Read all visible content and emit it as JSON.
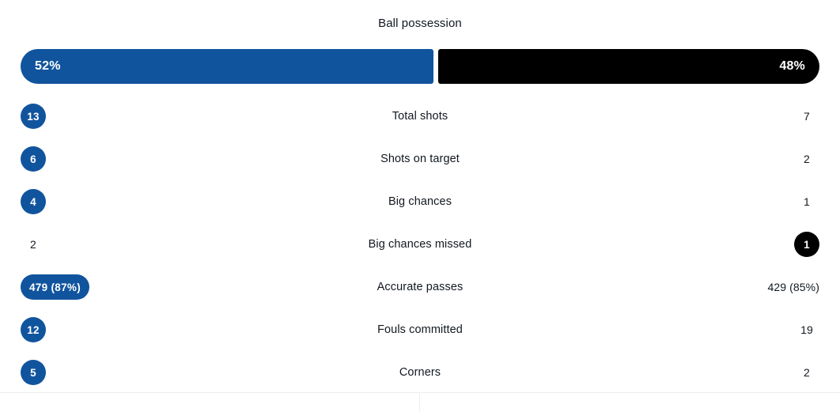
{
  "panel": {
    "possession": {
      "title": "Ball possession",
      "home_label": "52%",
      "away_label": "48%",
      "home_value": 52,
      "away_value": 48,
      "home_color": "#11549e",
      "away_color": "#000000"
    },
    "stats": [
      {
        "label": "Total shots",
        "home": "13",
        "away": "7",
        "home_highlight": true,
        "away_highlight": false
      },
      {
        "label": "Shots on target",
        "home": "6",
        "away": "2",
        "home_highlight": true,
        "away_highlight": false
      },
      {
        "label": "Big chances",
        "home": "4",
        "away": "1",
        "home_highlight": true,
        "away_highlight": false
      },
      {
        "label": "Big chances missed",
        "home": "2",
        "away": "1",
        "home_highlight": false,
        "away_highlight": true
      },
      {
        "label": "Accurate passes",
        "home": "479 (87%)",
        "away": "429 (85%)",
        "home_highlight": true,
        "away_highlight": false
      },
      {
        "label": "Fouls committed",
        "home": "12",
        "away": "19",
        "home_highlight": true,
        "away_highlight": false
      },
      {
        "label": "Corners",
        "home": "5",
        "away": "2",
        "home_highlight": true,
        "away_highlight": false
      }
    ]
  }
}
